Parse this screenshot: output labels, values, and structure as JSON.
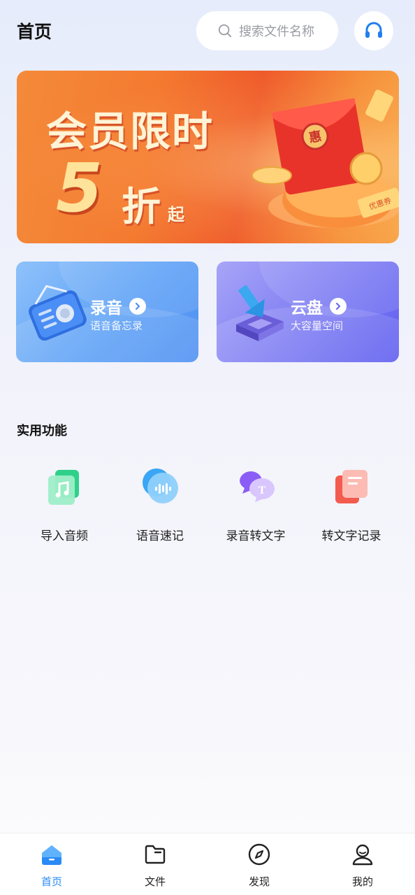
{
  "header": {
    "title": "首页",
    "search_placeholder": "搜索文件名称",
    "service_icon": "headset-icon"
  },
  "banner": {
    "line1": "会员限时",
    "number": "5",
    "unit": "折",
    "suffix": "起",
    "art_text_seal": "惠",
    "art_text_coupon": "优惠券",
    "colors": {
      "start": "#f48a3a",
      "end": "#ef5a2a",
      "text": "#fff4d6"
    }
  },
  "cards": [
    {
      "id": "record",
      "title": "录音",
      "subtitle": "语音备忘录",
      "icon": "radio-recorder-icon",
      "color": "#5fa2f6"
    },
    {
      "id": "cloud",
      "title": "云盘",
      "subtitle": "大容量空间",
      "icon": "cloud-download-icon",
      "color": "#7d7cf3"
    }
  ],
  "section": {
    "title": "实用功能",
    "items": [
      {
        "label": "导入音频",
        "icon": "music-file-icon",
        "color": "#3ccf8e"
      },
      {
        "label": "语音速记",
        "icon": "voice-wave-icon",
        "color": "#3aa6f5"
      },
      {
        "label": "录音转文字",
        "icon": "chat-text-icon",
        "color": "#8b5cf6"
      },
      {
        "label": "转文字记录",
        "icon": "document-record-icon",
        "color": "#f25b4e"
      }
    ]
  },
  "bottom_nav": {
    "active_color": "#2a8af5",
    "items": [
      {
        "label": "首页",
        "icon": "home-icon",
        "active": true
      },
      {
        "label": "文件",
        "icon": "folder-icon",
        "active": false
      },
      {
        "label": "发现",
        "icon": "compass-icon",
        "active": false
      },
      {
        "label": "我的",
        "icon": "profile-icon",
        "active": false
      }
    ]
  }
}
